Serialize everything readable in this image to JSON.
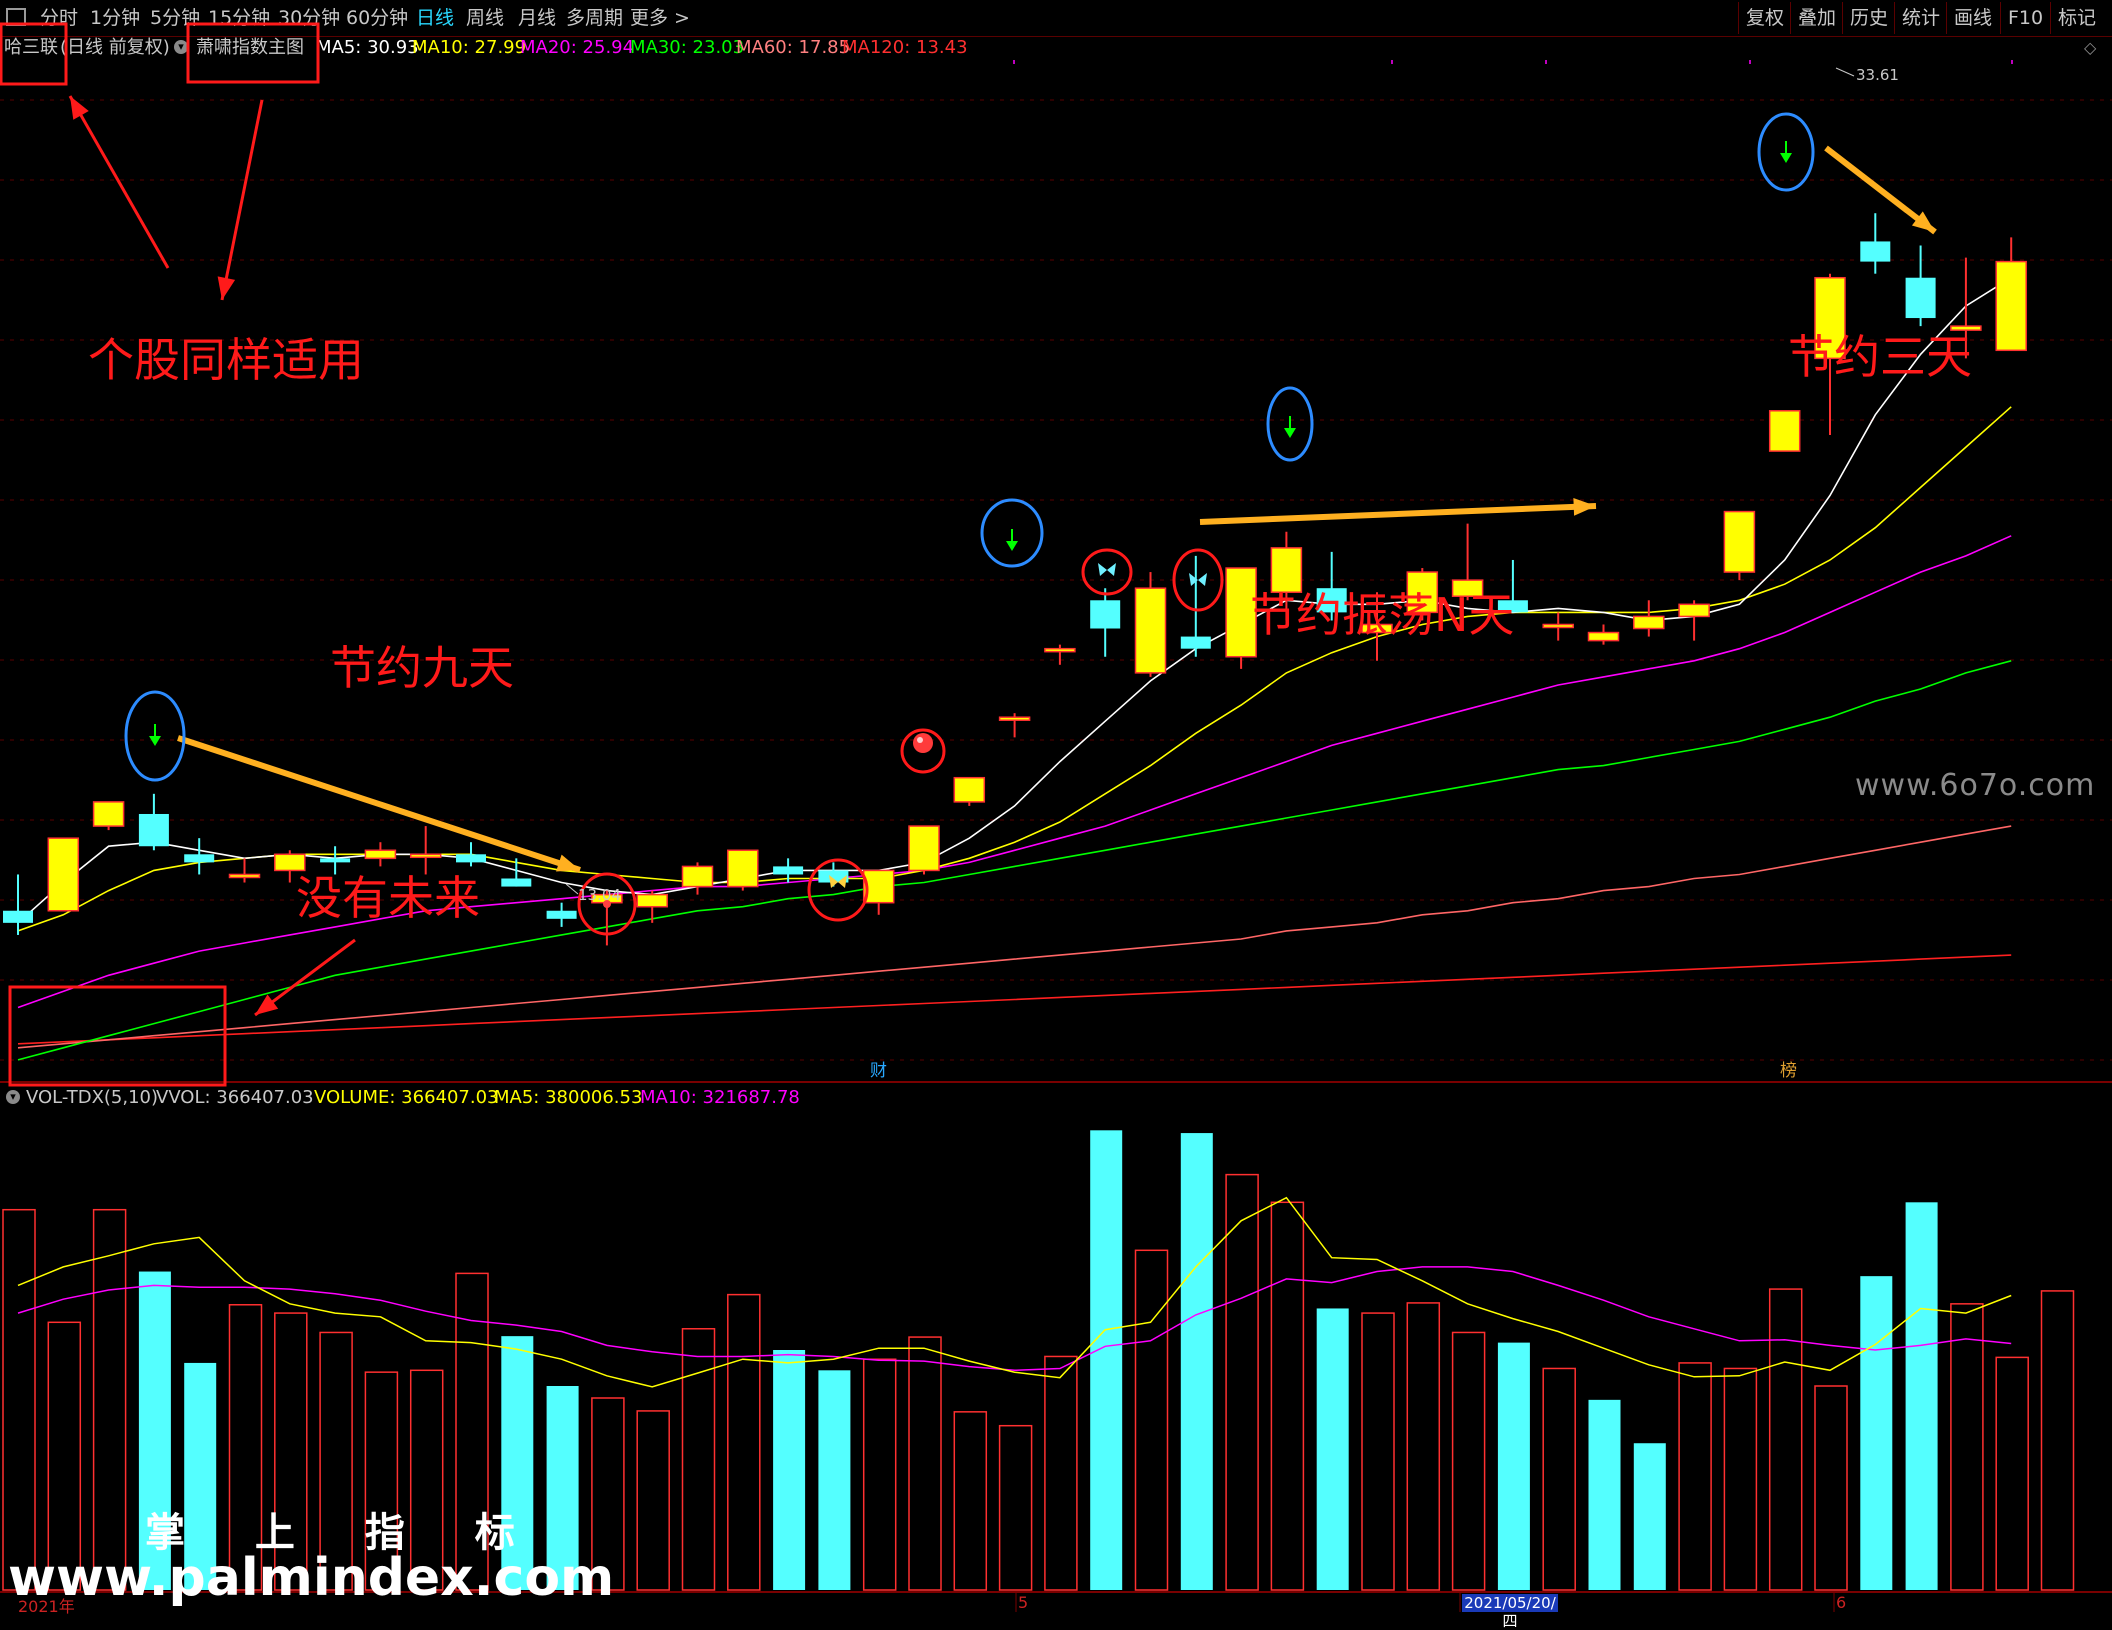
{
  "toolbar": {
    "left_items": [
      "分时",
      "1分钟",
      "5分钟",
      "15分钟",
      "30分钟",
      "60分钟",
      "日线",
      "周线",
      "月线",
      "多周期",
      "更多 >"
    ],
    "right_items": [
      "复权",
      "叠加",
      "历史",
      "统计",
      "画线",
      "F10",
      "标记"
    ],
    "active": "日线"
  },
  "main_info": {
    "stock_name": "哈三联",
    "period": "(日线 前复权)",
    "indicator_name": "萧啸指数主图",
    "ma5": "MA5: 30.93",
    "ma10": "MA10: 27.99",
    "ma20": "MA20: 25.94",
    "ma30": "MA30: 23.03",
    "ma60": "MA60: 17.85",
    "ma120": "MA120: 13.43"
  },
  "volume_info": {
    "name": "VOL-TDX(5,10)",
    "vvol": "VVOL: 366407.03",
    "volume": "VOLUME: 366407.03",
    "ma5": "MA5: 380006.53",
    "ma10": "MA10: 321687.78"
  },
  "price_markers": {
    "high": "33.61",
    "low": "13.04"
  },
  "event_tags": {
    "cai": "财",
    "bang": "榜"
  },
  "annotations": {
    "geigu": "个股同样适用",
    "jieyue_jiutian": "节约九天",
    "meiyou_weilai": "没有未来",
    "jieyue_zhendang": "节约振荡N天",
    "jieyue_santian": "节约三天"
  },
  "watermarks": {
    "site_6070": "www.6o7o.com",
    "zhangshang": "掌 上 指 标",
    "palmindex": "www.palmindex.com"
  },
  "date_axis": {
    "year_label": "2021年",
    "month5": "5",
    "cursor_date": "2021/05/20/四",
    "month6": "6"
  },
  "colors": {
    "background": "#000000",
    "up_candle": "#ffff00",
    "down_candle": "#54ffff",
    "ma5": "#ffffff",
    "ma10": "#ffff00",
    "ma20": "#ff00ff",
    "ma30": "#00ff00",
    "ma60": "#ff6666",
    "ma120": "#ff2020",
    "annotation": "#ff1a1a"
  },
  "chart_data": {
    "type": "candlestick",
    "period": "daily",
    "ohlc": [
      {
        "o": 13.9,
        "h": 14.8,
        "l": 13.3,
        "c": 13.6
      },
      {
        "o": 13.9,
        "h": 15.7,
        "l": 13.9,
        "c": 15.7
      },
      {
        "o": 16.0,
        "h": 16.6,
        "l": 15.9,
        "c": 16.6
      },
      {
        "o": 16.3,
        "h": 16.8,
        "l": 15.4,
        "c": 15.5
      },
      {
        "o": 15.3,
        "h": 15.7,
        "l": 14.8,
        "c": 15.1
      },
      {
        "o": 14.8,
        "h": 15.2,
        "l": 14.6,
        "c": 14.8
      },
      {
        "o": 14.9,
        "h": 15.4,
        "l": 14.6,
        "c": 15.3
      },
      {
        "o": 15.2,
        "h": 15.5,
        "l": 14.8,
        "c": 15.1
      },
      {
        "o": 15.2,
        "h": 15.6,
        "l": 15.0,
        "c": 15.4
      },
      {
        "o": 15.3,
        "h": 16.0,
        "l": 14.8,
        "c": 15.3
      },
      {
        "o": 15.3,
        "h": 15.6,
        "l": 15.0,
        "c": 15.1
      },
      {
        "o": 14.7,
        "h": 15.2,
        "l": 14.5,
        "c": 14.5
      },
      {
        "o": 13.9,
        "h": 14.1,
        "l": 13.5,
        "c": 13.7
      },
      {
        "o": 14.1,
        "h": 14.4,
        "l": 13.04,
        "c": 14.3
      },
      {
        "o": 14.0,
        "h": 14.4,
        "l": 13.6,
        "c": 14.3
      },
      {
        "o": 14.5,
        "h": 15.1,
        "l": 14.3,
        "c": 15.0
      },
      {
        "o": 14.5,
        "h": 15.4,
        "l": 14.4,
        "c": 15.4
      },
      {
        "o": 15.0,
        "h": 15.2,
        "l": 14.6,
        "c": 14.8
      },
      {
        "o": 14.9,
        "h": 15.1,
        "l": 14.5,
        "c": 14.6
      },
      {
        "o": 14.1,
        "h": 14.9,
        "l": 13.8,
        "c": 14.9
      },
      {
        "o": 14.9,
        "h": 16.0,
        "l": 14.8,
        "c": 16.0
      },
      {
        "o": 16.6,
        "h": 17.2,
        "l": 16.5,
        "c": 17.2
      },
      {
        "o": 18.7,
        "h": 18.8,
        "l": 18.2,
        "c": 18.7
      },
      {
        "o": 20.4,
        "h": 20.5,
        "l": 20.0,
        "c": 20.4
      },
      {
        "o": 21.6,
        "h": 21.9,
        "l": 20.2,
        "c": 20.9
      },
      {
        "o": 19.8,
        "h": 22.3,
        "l": 19.7,
        "c": 21.9
      },
      {
        "o": 20.7,
        "h": 22.7,
        "l": 20.2,
        "c": 20.4
      },
      {
        "o": 20.2,
        "h": 22.4,
        "l": 19.9,
        "c": 22.4
      },
      {
        "o": 21.8,
        "h": 23.3,
        "l": 21.1,
        "c": 22.9
      },
      {
        "o": 21.9,
        "h": 22.8,
        "l": 21.1,
        "c": 21.3
      },
      {
        "o": 20.8,
        "h": 21.8,
        "l": 20.1,
        "c": 21.0
      },
      {
        "o": 21.3,
        "h": 22.4,
        "l": 21.1,
        "c": 22.3
      },
      {
        "o": 21.7,
        "h": 23.5,
        "l": 21.6,
        "c": 22.1
      },
      {
        "o": 21.6,
        "h": 22.6,
        "l": 21.4,
        "c": 21.3
      },
      {
        "o": 21.0,
        "h": 21.3,
        "l": 20.6,
        "c": 21.0
      },
      {
        "o": 20.6,
        "h": 21.0,
        "l": 20.5,
        "c": 20.8
      },
      {
        "o": 20.9,
        "h": 21.6,
        "l": 20.7,
        "c": 21.2
      },
      {
        "o": 21.2,
        "h": 21.6,
        "l": 20.6,
        "c": 21.5
      },
      {
        "o": 22.3,
        "h": 23.8,
        "l": 22.1,
        "c": 23.8
      },
      {
        "o": 25.3,
        "h": 26.3,
        "l": 25.3,
        "c": 26.3
      },
      {
        "o": 27.6,
        "h": 29.7,
        "l": 25.7,
        "c": 29.6
      },
      {
        "o": 30.5,
        "h": 31.2,
        "l": 29.7,
        "c": 30.0
      },
      {
        "o": 29.6,
        "h": 30.4,
        "l": 28.4,
        "c": 28.6
      },
      {
        "o": 28.3,
        "h": 30.1,
        "l": 27.6,
        "c": 28.4
      },
      {
        "o": 27.8,
        "h": 30.6,
        "l": 27.8,
        "c": 30.0
      }
    ],
    "ma5": [
      13.6,
      14.6,
      15.5,
      15.6,
      15.4,
      15.2,
      15.3,
      15.2,
      15.3,
      15.3,
      15.2,
      14.9,
      14.6,
      14.4,
      14.3,
      14.5,
      14.7,
      14.9,
      14.9,
      14.9,
      15.1,
      15.7,
      16.5,
      17.6,
      18.6,
      19.6,
      20.4,
      21.0,
      21.6,
      21.5,
      21.5,
      21.6,
      21.4,
      21.3,
      21.4,
      21.3,
      21.1,
      21.2,
      21.5,
      22.6,
      24.2,
      26.2,
      27.7,
      28.9,
      29.6
    ],
    "ma10": [
      13.4,
      13.8,
      14.4,
      14.9,
      15.1,
      15.2,
      15.3,
      15.3,
      15.3,
      15.3,
      15.3,
      15.1,
      14.9,
      14.8,
      14.7,
      14.6,
      14.6,
      14.7,
      14.7,
      14.7,
      14.9,
      15.2,
      15.6,
      16.1,
      16.8,
      17.5,
      18.3,
      19.0,
      19.8,
      20.3,
      20.7,
      21.0,
      21.2,
      21.3,
      21.3,
      21.3,
      21.3,
      21.4,
      21.6,
      22.0,
      22.6,
      23.4,
      24.4,
      25.4,
      26.4
    ],
    "ma20": [
      11.5,
      11.9,
      12.3,
      12.6,
      12.9,
      13.1,
      13.3,
      13.5,
      13.7,
      13.9,
      14.0,
      14.1,
      14.2,
      14.3,
      14.4,
      14.5,
      14.5,
      14.6,
      14.7,
      14.8,
      14.9,
      15.1,
      15.4,
      15.7,
      16.0,
      16.4,
      16.8,
      17.2,
      17.6,
      18.0,
      18.3,
      18.6,
      18.9,
      19.2,
      19.5,
      19.7,
      19.9,
      20.1,
      20.4,
      20.8,
      21.3,
      21.8,
      22.3,
      22.7,
      23.2
    ],
    "ma30": [
      10.2,
      10.5,
      10.8,
      11.1,
      11.4,
      11.7,
      12.0,
      12.3,
      12.5,
      12.7,
      12.9,
      13.1,
      13.3,
      13.5,
      13.7,
      13.9,
      14.0,
      14.2,
      14.3,
      14.5,
      14.6,
      14.8,
      15.0,
      15.2,
      15.4,
      15.6,
      15.8,
      16.0,
      16.2,
      16.4,
      16.6,
      16.8,
      17.0,
      17.2,
      17.4,
      17.5,
      17.7,
      17.9,
      18.1,
      18.4,
      18.7,
      19.1,
      19.4,
      19.8,
      20.1
    ],
    "ma60": [
      10.5,
      10.6,
      10.7,
      10.8,
      10.9,
      11.0,
      11.1,
      11.2,
      11.3,
      11.4,
      11.5,
      11.6,
      11.7,
      11.8,
      11.9,
      12.0,
      12.1,
      12.2,
      12.3,
      12.4,
      12.5,
      12.6,
      12.7,
      12.8,
      12.9,
      13.0,
      13.1,
      13.2,
      13.4,
      13.5,
      13.6,
      13.8,
      13.9,
      14.1,
      14.2,
      14.4,
      14.5,
      14.7,
      14.8,
      15.0,
      15.2,
      15.4,
      15.6,
      15.8,
      16.0
    ],
    "ma120": [
      10.6,
      10.65,
      10.7,
      10.75,
      10.8,
      10.85,
      10.9,
      10.95,
      11.0,
      11.05,
      11.1,
      11.15,
      11.2,
      11.25,
      11.3,
      11.35,
      11.4,
      11.45,
      11.5,
      11.55,
      11.6,
      11.65,
      11.7,
      11.75,
      11.8,
      11.85,
      11.9,
      11.95,
      12.0,
      12.05,
      12.1,
      12.15,
      12.2,
      12.25,
      12.3,
      12.35,
      12.4,
      12.45,
      12.5,
      12.55,
      12.6,
      12.65,
      12.7,
      12.75,
      12.8
    ],
    "volume": [
      412000,
      290000,
      412000,
      345000,
      246000,
      309000,
      300000,
      279000,
      236000,
      238000,
      343000,
      275000,
      221000,
      208000,
      194000,
      283000,
      320000,
      260000,
      238000,
      250000,
      274000,
      193000,
      178000,
      253000,
      498000,
      368000,
      495000,
      450000,
      420000,
      305000,
      300000,
      311000,
      279000,
      268000,
      240000,
      206000,
      159000,
      246000,
      240000,
      326000,
      221000,
      340000,
      420000,
      310000,
      252000,
      324000
    ],
    "volume_up": [
      true,
      true,
      true,
      false,
      false,
      true,
      true,
      true,
      true,
      true,
      true,
      false,
      false,
      true,
      true,
      true,
      true,
      false,
      false,
      true,
      true,
      true,
      true,
      true,
      false,
      true,
      false,
      true,
      true,
      false,
      true,
      true,
      true,
      false,
      true,
      false,
      false,
      true,
      true,
      true,
      true,
      false,
      false,
      true,
      true,
      true
    ],
    "vol_ma5": [
      330000,
      350000,
      362000,
      375000,
      382000,
      335000,
      310000,
      300000,
      296000,
      270000,
      268000,
      261000,
      250000,
      232000,
      220000,
      235000,
      250000,
      246000,
      250000,
      262000,
      262000,
      248000,
      236000,
      230000,
      282000,
      290000,
      350000,
      400000,
      425000,
      360000,
      358000,
      335000,
      310000,
      294000,
      280000,
      262000,
      244000,
      231000,
      232000,
      247000,
      238000,
      266000,
      305000,
      300000,
      319000
    ],
    "vol_ma10": [
      300000,
      315000,
      325000,
      330000,
      328000,
      328000,
      326000,
      321000,
      314000,
      302000,
      292000,
      287000,
      280000,
      265000,
      258000,
      253000,
      253000,
      255000,
      253000,
      249000,
      248000,
      242000,
      238000,
      240000,
      264000,
      270000,
      298000,
      316000,
      337000,
      333000,
      345000,
      350000,
      350000,
      345000,
      330000,
      314000,
      296000,
      283000,
      270000,
      271000,
      265000,
      260000,
      265000,
      272000,
      267000
    ],
    "ylim_price": [
      10.0,
      35.0
    ],
    "ylim_volume": [
      0,
      520000
    ]
  }
}
